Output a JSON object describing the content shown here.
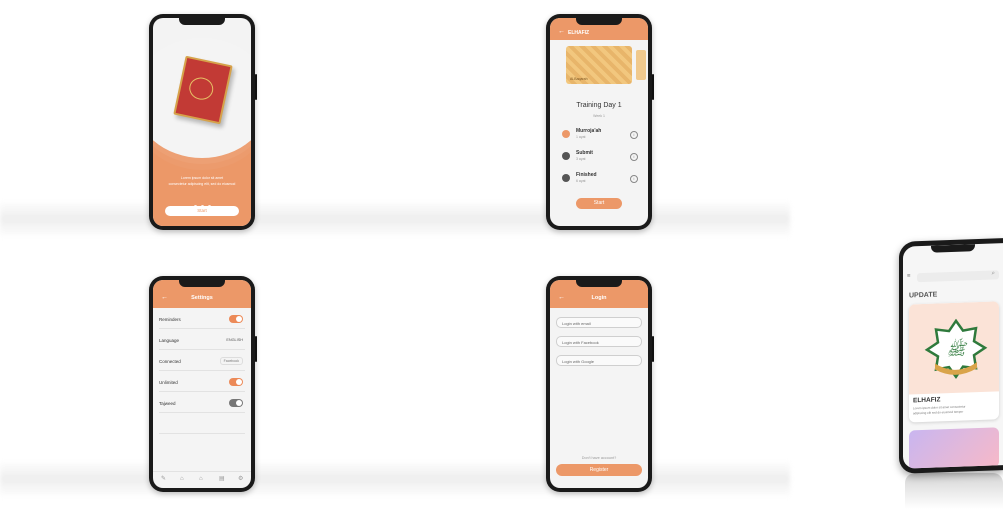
{
  "phone1": {
    "caption_line1": "Lorem ipsum dolor sit amet",
    "caption_line2": "consectetur adipiscing elit, sed do eiusmod",
    "start_button": "Start"
  },
  "phone2": {
    "header_title": "ELHAFIZ",
    "banner_caption": "Al-Baqarah",
    "title": "Training Day 1",
    "subtitle": "Week 1",
    "steps": [
      {
        "title": "Murroja'ah",
        "sub": "1 ayat"
      },
      {
        "title": "Submit",
        "sub": "3 ayat"
      },
      {
        "title": "Finished",
        "sub": "6 ayat"
      }
    ],
    "start_button": "Start"
  },
  "phone3": {
    "header_title": "Settings",
    "rows": [
      {
        "label": "Reminders"
      },
      {
        "label": "Language",
        "value": "ENGLISH"
      },
      {
        "label": "Connected",
        "value": "Facebook"
      },
      {
        "label": "Unlimited"
      },
      {
        "label": "Tajweed"
      }
    ]
  },
  "phone4": {
    "header_title": "Login",
    "fields": [
      "Login with email",
      "Login with Facebook",
      "Login with Google"
    ],
    "no_account": "Don't have account?",
    "register_button": "Register"
  },
  "phone5": {
    "section_title": "UPDATE",
    "app_name": "ELHAFIZ",
    "description_line1": "Lorem ipsum dolor sit amet consectetur",
    "description_line2": "adipiscing elit sed do eiusmod tempor"
  },
  "colors": {
    "accent": "#ec9868",
    "book": "#c23a35"
  }
}
